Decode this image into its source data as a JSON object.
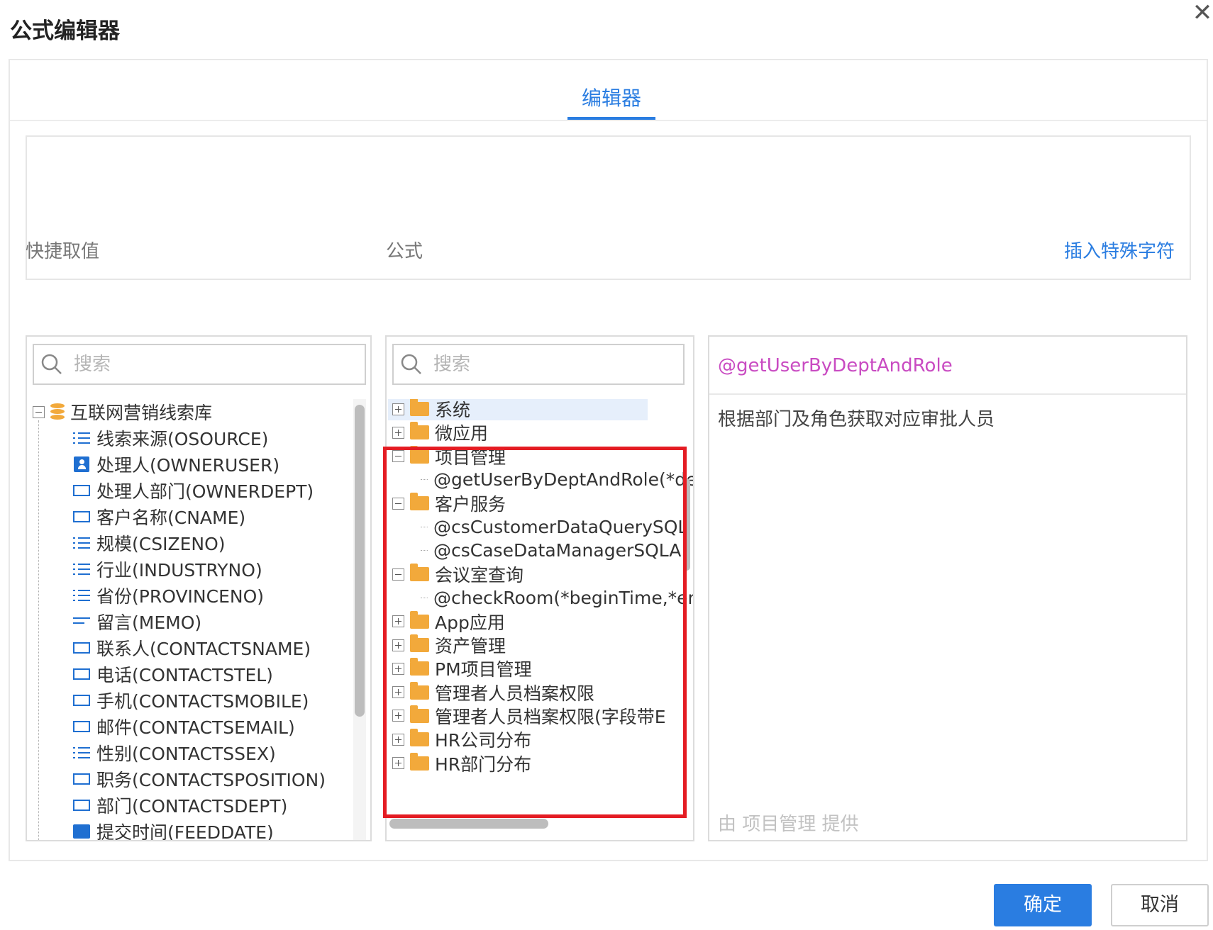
{
  "dialog": {
    "title": "公式编辑器",
    "close_symbol": "✕"
  },
  "tabs": [
    {
      "label": "编辑器",
      "active": true
    }
  ],
  "labels": {
    "quick_values": "快捷取值",
    "formula": "公式",
    "insert_special": "插入特殊字符"
  },
  "quick_panel": {
    "search_placeholder": "搜索",
    "root": "互联网营销线索库",
    "fields": [
      {
        "label": "线索来源(OSOURCE)",
        "icon": "list-icon"
      },
      {
        "label": "处理人(OWNERUSER)",
        "icon": "user-icon"
      },
      {
        "label": "处理人部门(OWNERDEPT)",
        "icon": "text-field-icon"
      },
      {
        "label": "客户名称(CNAME)",
        "icon": "text-field-icon"
      },
      {
        "label": "规模(CSIZENO)",
        "icon": "list-icon"
      },
      {
        "label": "行业(INDUSTRYNO)",
        "icon": "list-icon"
      },
      {
        "label": "省份(PROVINCENO)",
        "icon": "list-icon"
      },
      {
        "label": "留言(MEMO)",
        "icon": "memo-icon"
      },
      {
        "label": "联系人(CONTACTSNAME)",
        "icon": "text-field-icon"
      },
      {
        "label": "电话(CONTACTSTEL)",
        "icon": "text-field-icon"
      },
      {
        "label": "手机(CONTACTSMOBILE)",
        "icon": "text-field-icon"
      },
      {
        "label": "邮件(CONTACTSEMAIL)",
        "icon": "text-field-icon"
      },
      {
        "label": "性别(CONTACTSSEX)",
        "icon": "list-icon"
      },
      {
        "label": "职务(CONTACTSPOSITION)",
        "icon": "text-field-icon"
      },
      {
        "label": "部门(CONTACTSDEPT)",
        "icon": "text-field-icon"
      },
      {
        "label": "提交时间(FEEDDATE)",
        "icon": "calendar-icon"
      }
    ]
  },
  "formula_panel": {
    "search_placeholder": "搜索",
    "items": [
      {
        "label": "系统",
        "type": "folder",
        "expanded": false
      },
      {
        "label": "微应用",
        "type": "folder",
        "expanded": false
      },
      {
        "label": "项目管理",
        "type": "folder",
        "expanded": true
      },
      {
        "label": "@getUserByDeptAndRole(*de",
        "type": "func"
      },
      {
        "label": "客户服务",
        "type": "folder",
        "expanded": true
      },
      {
        "label": "@csCustomerDataQuerySQL",
        "type": "func"
      },
      {
        "label": "@csCaseDataManagerSQLA",
        "type": "func"
      },
      {
        "label": "会议室查询",
        "type": "folder",
        "expanded": true
      },
      {
        "label": "@checkRoom(*beginTime,*en",
        "type": "func"
      },
      {
        "label": "App应用",
        "type": "folder",
        "expanded": false
      },
      {
        "label": "资产管理",
        "type": "folder",
        "expanded": false
      },
      {
        "label": "PM项目管理",
        "type": "folder",
        "expanded": false
      },
      {
        "label": "管理者人员档案权限",
        "type": "folder",
        "expanded": false
      },
      {
        "label": "管理者人员档案权限(字段带E",
        "type": "folder",
        "expanded": false
      },
      {
        "label": "HR公司分布",
        "type": "folder",
        "expanded": false
      },
      {
        "label": "HR部门分布",
        "type": "folder",
        "expanded": false
      }
    ]
  },
  "detail_panel": {
    "function_name": "@getUserByDeptAndRole",
    "description": "根据部门及角色获取对应审批人员",
    "provider": "由 项目管理 提供"
  },
  "buttons": {
    "ok": "确定",
    "cancel": "取消"
  },
  "colors": {
    "accent": "#2a7de1",
    "function_name": "#c94bc2",
    "folder": "#f2a93b",
    "highlight_box": "#e41c23"
  }
}
